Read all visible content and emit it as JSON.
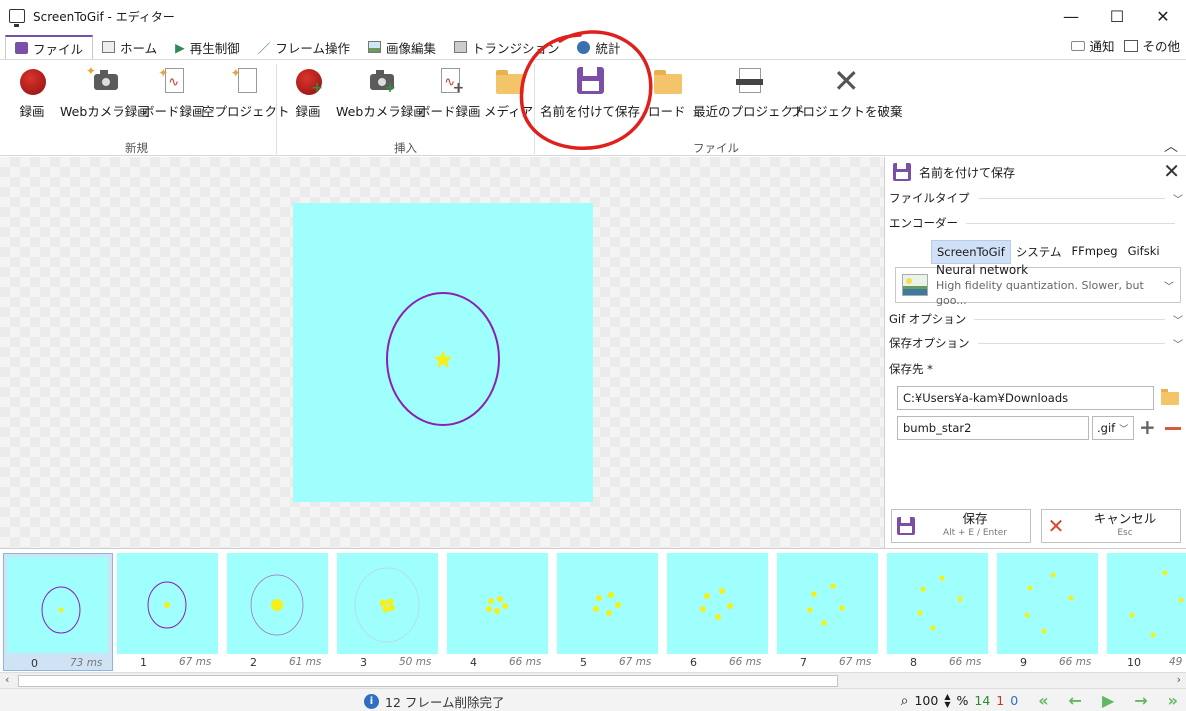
{
  "window": {
    "title": "ScreenToGif - エディター",
    "minimize": "—",
    "maximize": "☐",
    "close": "✕"
  },
  "tabs": [
    {
      "label": "ファイル",
      "active": true
    },
    {
      "label": "ホーム"
    },
    {
      "label": "再生制御"
    },
    {
      "label": "フレーム操作"
    },
    {
      "label": "画像編集"
    },
    {
      "label": "トランジション"
    },
    {
      "label": "統計"
    }
  ],
  "tabs_right": {
    "notify": "通知",
    "other": "その他"
  },
  "ribbon": {
    "new_group": "新規",
    "insert_group": "挿入",
    "file_group": "ファイル",
    "buttons": {
      "record": "録画",
      "webcam": "Webカメラ録画",
      "board": "ボード録画",
      "blank": "空プロジェクト",
      "ins_record": "録画",
      "ins_webcam": "Webカメラ録画",
      "ins_board": "ボード録画",
      "media": "メディア",
      "save_as": "名前を付けて保存",
      "load": "ロード",
      "recent": "最近のプロジェクト",
      "discard": "プロジェクトを破棄"
    }
  },
  "panel": {
    "title": "名前を付けて保存",
    "file_type": "ファイルタイプ",
    "encoder": "エンコーダー",
    "encoders": [
      "ScreenToGif",
      "システム",
      "FFmpeg",
      "Gifski"
    ],
    "selected_encoder": "ScreenToGif",
    "preset_title": "Neural network",
    "preset_desc": "High fidelity quantization. Slower, but goo...",
    "gif_options": "Gif オプション",
    "save_options": "保存オプション",
    "save_to": "保存先 *",
    "path": "C:¥Users¥a-kam¥Downloads",
    "filename": "bumb_star2",
    "extension": ".gif",
    "save_button": "保存",
    "save_shortcut": "Alt + E / Enter",
    "cancel_button": "キャンセル",
    "cancel_shortcut": "Esc"
  },
  "frames": [
    {
      "index": "0",
      "ms": "73 ms"
    },
    {
      "index": "1",
      "ms": "67 ms"
    },
    {
      "index": "2",
      "ms": "61 ms"
    },
    {
      "index": "3",
      "ms": "50 ms"
    },
    {
      "index": "4",
      "ms": "66 ms"
    },
    {
      "index": "5",
      "ms": "67 ms"
    },
    {
      "index": "6",
      "ms": "66 ms"
    },
    {
      "index": "7",
      "ms": "67 ms"
    },
    {
      "index": "8",
      "ms": "66 ms"
    },
    {
      "index": "9",
      "ms": "66 ms"
    },
    {
      "index": "10",
      "ms": "49"
    }
  ],
  "status": {
    "message": "12 フレーム削除完了",
    "zoom": "100",
    "zoom_unit": "%",
    "frame_count": "14",
    "selected_count": "1",
    "current_index": "0"
  },
  "colors": {
    "accent": "#7b4fa6",
    "frame_bg": "#9ffffc",
    "annotation": "#e0201c"
  }
}
